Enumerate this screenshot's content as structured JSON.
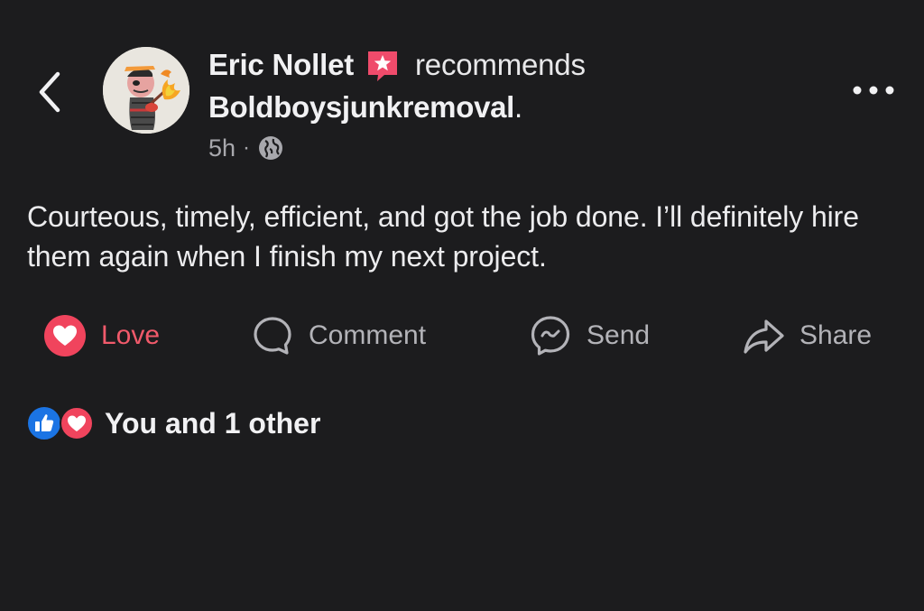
{
  "post": {
    "author": "Eric Nollet",
    "action_text": "recommends",
    "page_name": "Boldboysjunkremoval",
    "page_suffix": ".",
    "time": "5h",
    "separator": "·",
    "privacy_icon": "globe-icon",
    "recommend_badge_icon": "star-badge-icon",
    "body": "Courteous, timely, efficient, and got the job done.  I’ll definitely hire them again when I finish my next project."
  },
  "nav": {
    "back_icon": "chevron-left-icon",
    "more_icon": "more-horizontal-icon"
  },
  "actions": {
    "love_label": "Love",
    "comment_label": "Comment",
    "send_label": "Send",
    "share_label": "Share"
  },
  "reactions": {
    "summary": "You and 1 other",
    "icons": [
      "like-reaction-icon",
      "love-reaction-icon"
    ]
  },
  "colors": {
    "background": "#1c1c1e",
    "love_accent": "#f15a6b",
    "like_blue": "#1b74e4",
    "badge_pink": "#ef4b6b"
  }
}
